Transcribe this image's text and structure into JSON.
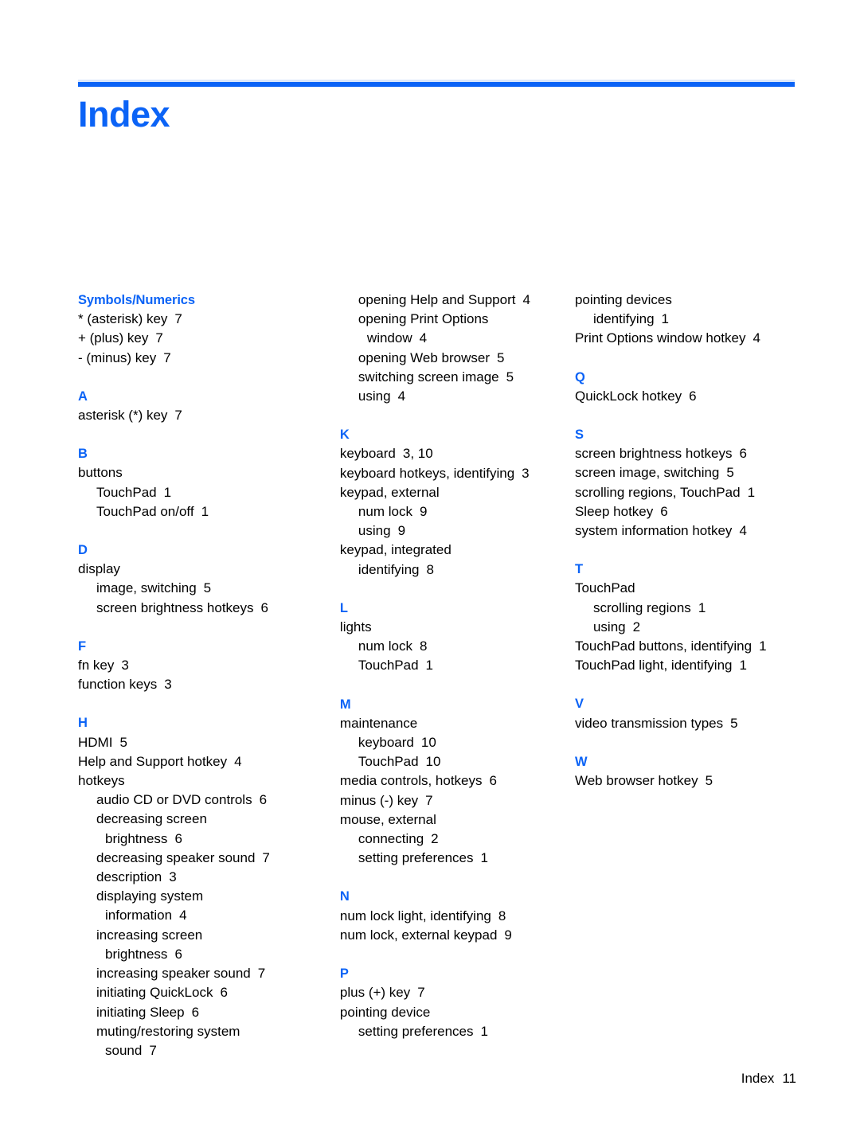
{
  "header": {
    "title": "Index",
    "rule_color": "#0b63f6"
  },
  "footer": {
    "label": "Index",
    "page_number": "11"
  },
  "accent_color": "#0b63f6",
  "columns": [
    {
      "id": "column-1",
      "groups": [
        {
          "letter": "Symbols/Numerics",
          "entries": [
            {
              "level": 0,
              "text": "* (asterisk) key",
              "page": "7"
            },
            {
              "level": 0,
              "text": "+ (plus) key",
              "page": "7"
            },
            {
              "level": 0,
              "text": "- (minus) key",
              "page": "7"
            }
          ]
        },
        {
          "letter": "A",
          "entries": [
            {
              "level": 0,
              "text": "asterisk (*) key",
              "page": "7"
            }
          ]
        },
        {
          "letter": "B",
          "entries": [
            {
              "level": 0,
              "text": "buttons",
              "page": ""
            },
            {
              "level": 1,
              "text": "TouchPad",
              "page": "1"
            },
            {
              "level": 1,
              "text": "TouchPad on/off",
              "page": "1"
            }
          ]
        },
        {
          "letter": "D",
          "entries": [
            {
              "level": 0,
              "text": "display",
              "page": ""
            },
            {
              "level": 1,
              "text": "image, switching",
              "page": "5"
            },
            {
              "level": 1,
              "text": "screen brightness hotkeys",
              "page": "6"
            }
          ]
        },
        {
          "letter": "F",
          "entries": [
            {
              "level": 0,
              "text": "fn key",
              "page": "3"
            },
            {
              "level": 0,
              "text": "function keys",
              "page": "3"
            }
          ]
        },
        {
          "letter": "H",
          "entries": [
            {
              "level": 0,
              "text": "HDMI",
              "page": "5"
            },
            {
              "level": 0,
              "text": "Help and Support hotkey",
              "page": "4"
            },
            {
              "level": 0,
              "text": "hotkeys",
              "page": ""
            },
            {
              "level": 1,
              "text": "audio CD or DVD controls",
              "page": "6"
            },
            {
              "level": 1,
              "text": "decreasing screen",
              "page": ""
            },
            {
              "level": 2,
              "text": "brightness",
              "page": "6"
            },
            {
              "level": 1,
              "text": "decreasing speaker sound",
              "page": "7"
            },
            {
              "level": 1,
              "text": "description",
              "page": "3"
            },
            {
              "level": 1,
              "text": "displaying system",
              "page": ""
            },
            {
              "level": 2,
              "text": "information",
              "page": "4"
            },
            {
              "level": 1,
              "text": "increasing screen",
              "page": ""
            },
            {
              "level": 2,
              "text": "brightness",
              "page": "6"
            },
            {
              "level": 1,
              "text": "increasing speaker sound",
              "page": "7"
            },
            {
              "level": 1,
              "text": "initiating QuickLock",
              "page": "6"
            },
            {
              "level": 1,
              "text": "initiating Sleep",
              "page": "6"
            },
            {
              "level": 1,
              "text": "muting/restoring system",
              "page": ""
            },
            {
              "level": 2,
              "text": "sound",
              "page": "7"
            }
          ]
        }
      ]
    },
    {
      "id": "column-2",
      "groups": [
        {
          "letter": "",
          "entries": [
            {
              "level": 1,
              "text": "opening Help and Support",
              "page": "4"
            },
            {
              "level": 1,
              "text": "opening Print Options",
              "page": ""
            },
            {
              "level": 2,
              "text": "window",
              "page": "4"
            },
            {
              "level": 1,
              "text": "opening Web browser",
              "page": "5"
            },
            {
              "level": 1,
              "text": "switching screen image",
              "page": "5"
            },
            {
              "level": 1,
              "text": "using",
              "page": "4"
            }
          ]
        },
        {
          "letter": "K",
          "entries": [
            {
              "level": 0,
              "text": "keyboard",
              "page": "3, 10"
            },
            {
              "level": 0,
              "text": "keyboard hotkeys, identifying",
              "page": "3"
            },
            {
              "level": 0,
              "text": "keypad, external",
              "page": ""
            },
            {
              "level": 1,
              "text": "num lock",
              "page": "9"
            },
            {
              "level": 1,
              "text": "using",
              "page": "9"
            },
            {
              "level": 0,
              "text": "keypad, integrated",
              "page": ""
            },
            {
              "level": 1,
              "text": "identifying",
              "page": "8"
            }
          ]
        },
        {
          "letter": "L",
          "entries": [
            {
              "level": 0,
              "text": "lights",
              "page": ""
            },
            {
              "level": 1,
              "text": "num lock",
              "page": "8"
            },
            {
              "level": 1,
              "text": "TouchPad",
              "page": "1"
            }
          ]
        },
        {
          "letter": "M",
          "entries": [
            {
              "level": 0,
              "text": "maintenance",
              "page": ""
            },
            {
              "level": 1,
              "text": "keyboard",
              "page": "10"
            },
            {
              "level": 1,
              "text": "TouchPad",
              "page": "10"
            },
            {
              "level": 0,
              "text": "media controls, hotkeys",
              "page": "6"
            },
            {
              "level": 0,
              "text": "minus (-) key",
              "page": "7"
            },
            {
              "level": 0,
              "text": "mouse, external",
              "page": ""
            },
            {
              "level": 1,
              "text": "connecting",
              "page": "2"
            },
            {
              "level": 1,
              "text": "setting preferences",
              "page": "1"
            }
          ]
        },
        {
          "letter": "N",
          "entries": [
            {
              "level": 0,
              "text": "num lock light, identifying",
              "page": "8"
            },
            {
              "level": 0,
              "text": "num lock, external keypad",
              "page": "9"
            }
          ]
        },
        {
          "letter": "P",
          "entries": [
            {
              "level": 0,
              "text": "plus (+) key",
              "page": "7"
            },
            {
              "level": 0,
              "text": "pointing device",
              "page": ""
            },
            {
              "level": 1,
              "text": "setting preferences",
              "page": "1"
            }
          ]
        }
      ]
    },
    {
      "id": "column-3",
      "groups": [
        {
          "letter": "",
          "entries": [
            {
              "level": 0,
              "text": "pointing devices",
              "page": ""
            },
            {
              "level": 1,
              "text": "identifying",
              "page": "1"
            },
            {
              "level": 0,
              "text": "Print Options window hotkey",
              "page": "4"
            }
          ]
        },
        {
          "letter": "Q",
          "entries": [
            {
              "level": 0,
              "text": "QuickLock hotkey",
              "page": "6"
            }
          ]
        },
        {
          "letter": "S",
          "entries": [
            {
              "level": 0,
              "text": "screen brightness hotkeys",
              "page": "6"
            },
            {
              "level": 0,
              "text": "screen image, switching",
              "page": "5"
            },
            {
              "level": 0,
              "text": "scrolling regions, TouchPad",
              "page": "1"
            },
            {
              "level": 0,
              "text": "Sleep hotkey",
              "page": "6"
            },
            {
              "level": 0,
              "text": "system information hotkey",
              "page": "4"
            }
          ]
        },
        {
          "letter": "T",
          "entries": [
            {
              "level": 0,
              "text": "TouchPad",
              "page": ""
            },
            {
              "level": 1,
              "text": "scrolling regions",
              "page": "1"
            },
            {
              "level": 1,
              "text": "using",
              "page": "2"
            },
            {
              "level": 0,
              "text": "TouchPad buttons, identifying",
              "page": "1"
            },
            {
              "level": 0,
              "text": "TouchPad light, identifying",
              "page": "1"
            }
          ]
        },
        {
          "letter": "V",
          "entries": [
            {
              "level": 0,
              "text": "video transmission types",
              "page": "5"
            }
          ]
        },
        {
          "letter": "W",
          "entries": [
            {
              "level": 0,
              "text": "Web browser hotkey",
              "page": "5"
            }
          ]
        }
      ]
    }
  ]
}
